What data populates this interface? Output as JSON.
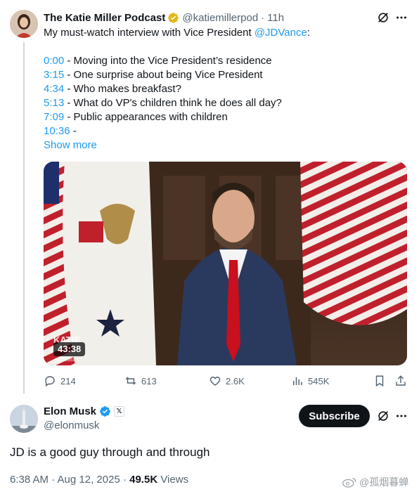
{
  "parent_tweet": {
    "author_name": "The Katie Miller Podcast",
    "handle": "@katiemillerpod",
    "separator": "·",
    "time": "11h",
    "text_prefix": "My must-watch interview with Vice President ",
    "mention": "@JDVance",
    "text_suffix": ":",
    "chapters": [
      {
        "ts": "0:00",
        "label": " - Moving into the Vice President’s residence"
      },
      {
        "ts": "3:15",
        "label": " - One surprise about being Vice President"
      },
      {
        "ts": "4:34",
        "label": " - Who makes breakfast?"
      },
      {
        "ts": "5:13",
        "label": " - What do VP's children think he does all day?"
      },
      {
        "ts": "7:09",
        "label": " - Public appearances with children"
      },
      {
        "ts": "10:36",
        "label": " -"
      }
    ],
    "show_more": "Show more",
    "video_duration": "43:38",
    "video_watermark": "KATIE",
    "video_watermark_sub": "podcast",
    "actions": {
      "replies": "214",
      "reposts": "613",
      "likes": "2.6K",
      "views": "545K"
    }
  },
  "reply_tweet": {
    "author_name": "Elon Musk",
    "handle": "@elonmusk",
    "affiliate_badge": "𝕏",
    "subscribe_label": "Subscribe",
    "text": "JD is a good guy through and through",
    "timestamp": "6:38 AM · Aug 12, 2025 · ",
    "views_count": "49.5K",
    "views_label": " Views"
  },
  "watermark": "@孤烟暮蝉",
  "colors": {
    "accent": "#1d9bf0",
    "text": "#0f1419",
    "muted": "#536471",
    "gold_verified": "#e2b719",
    "blue_verified": "#1d9bf0"
  }
}
